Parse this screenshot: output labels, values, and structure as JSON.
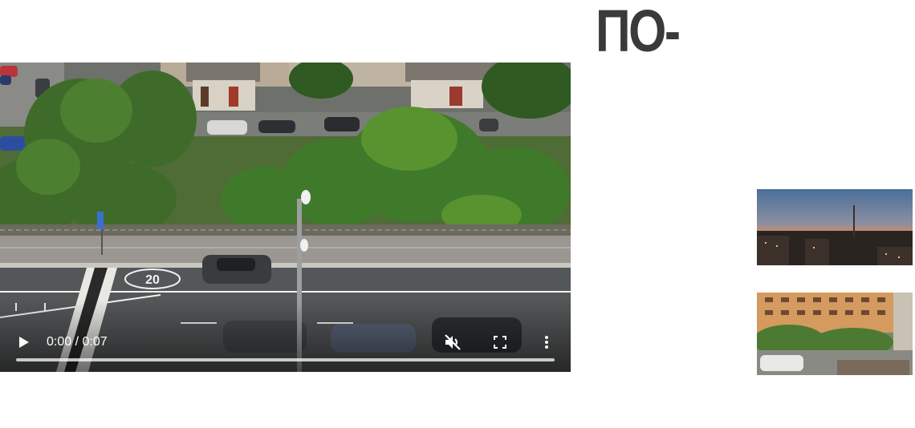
{
  "heading": "ПО-",
  "video": {
    "time_display": "0:00 / 0:07",
    "progress": 0,
    "icons": {
      "play": "play-icon",
      "mute": "volume-muted-icon",
      "fullscreen": "fullscreen-icon",
      "more": "more-vertical-icon"
    },
    "road_marking": "20"
  },
  "thumbnails": [
    {
      "name": "sunset-city-thumbnail"
    },
    {
      "name": "courtyard-buildings-thumbnail"
    }
  ],
  "colors": {
    "heading": "#3a3a3a",
    "controls": "#ffffff",
    "background": "#ffffff"
  }
}
